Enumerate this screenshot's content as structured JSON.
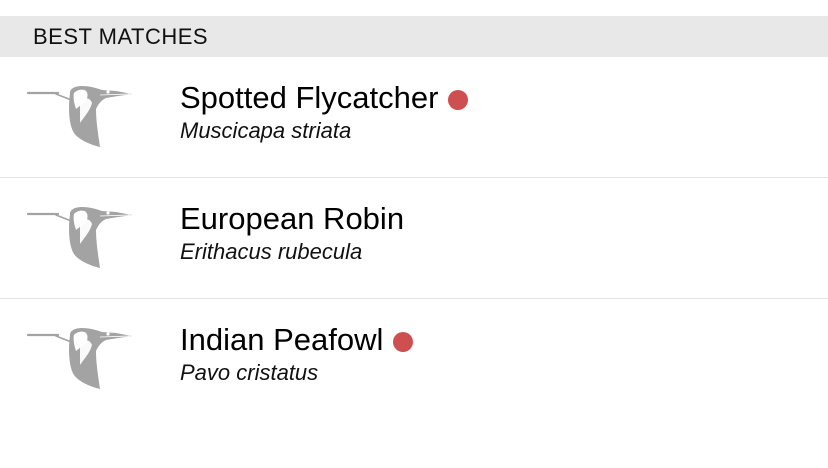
{
  "section": {
    "title": "BEST MATCHES"
  },
  "colors": {
    "header_bg": "#e8e8e8",
    "separator": "#e3e3e3",
    "sighting_dot": "#cd4f4f",
    "placeholder_icon": "#a3a3a3"
  },
  "results": [
    {
      "common_name": "Spotted Flycatcher",
      "scientific_name": "Muscicapa striata",
      "has_sighting_dot": true,
      "icon": "bird-silhouette-icon"
    },
    {
      "common_name": "European Robin",
      "scientific_name": "Erithacus rubecula",
      "has_sighting_dot": false,
      "icon": "bird-silhouette-icon"
    },
    {
      "common_name": "Indian Peafowl",
      "scientific_name": "Pavo cristatus",
      "has_sighting_dot": true,
      "icon": "bird-silhouette-icon"
    }
  ]
}
